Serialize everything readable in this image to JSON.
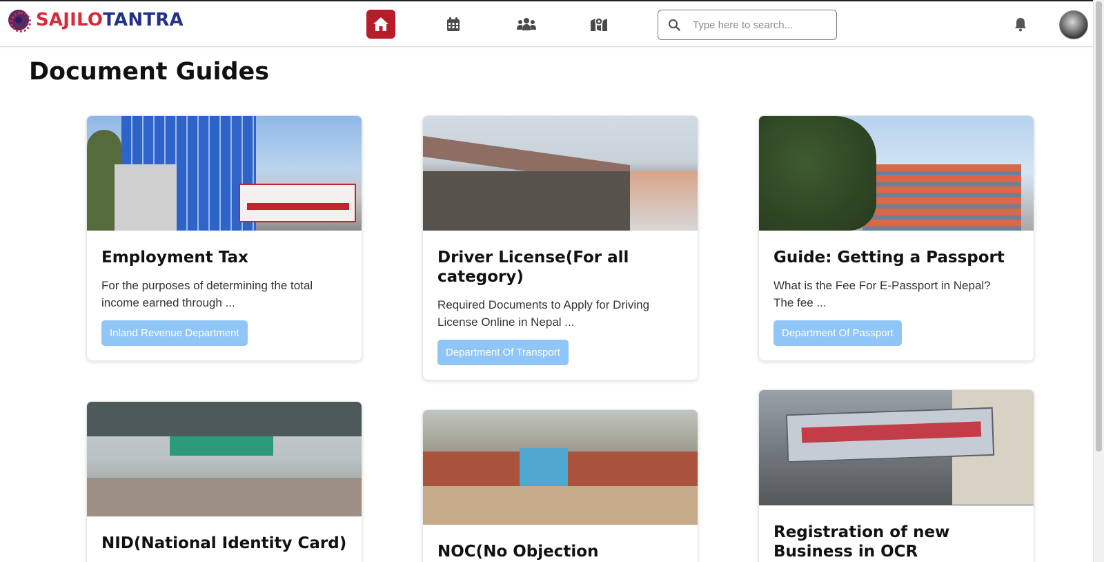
{
  "app": {
    "logo_part1": "SAJILO",
    "logo_part2": "TANTRA"
  },
  "nav": {
    "items": [
      {
        "name": "home",
        "icon": "home-icon",
        "active": true
      },
      {
        "name": "calendar",
        "icon": "calendar-icon",
        "active": false
      },
      {
        "name": "community",
        "icon": "users-icon",
        "active": false
      },
      {
        "name": "map",
        "icon": "map-icon",
        "active": false
      }
    ],
    "search_placeholder": "Type here to search..."
  },
  "colors": {
    "brand_red": "#d62b3a",
    "brand_blue": "#23318a",
    "active_nav": "#b71c2b",
    "tag_bg": "#90c5f7"
  },
  "page": {
    "title": "Document Guides"
  },
  "cards": [
    {
      "title": "Employment Tax",
      "description": "For the purposes of determining the total income earned through ...",
      "tag": "Inland Revenue Department"
    },
    {
      "title": "Driver License(For all category)",
      "description": "Required Documents to Apply for Driving License Online in Nepal ...",
      "tag": "Department Of Transport"
    },
    {
      "title": "Guide: Getting a Passport",
      "description": "What is the Fee For E-Passport in Nepal? The fee ...",
      "tag": "Department Of Passport"
    },
    {
      "title": "NID(National Identity Card)"
    },
    {
      "title": "NOC(No Objection Certificate)"
    },
    {
      "title": "Registration of new Business in OCR"
    }
  ]
}
